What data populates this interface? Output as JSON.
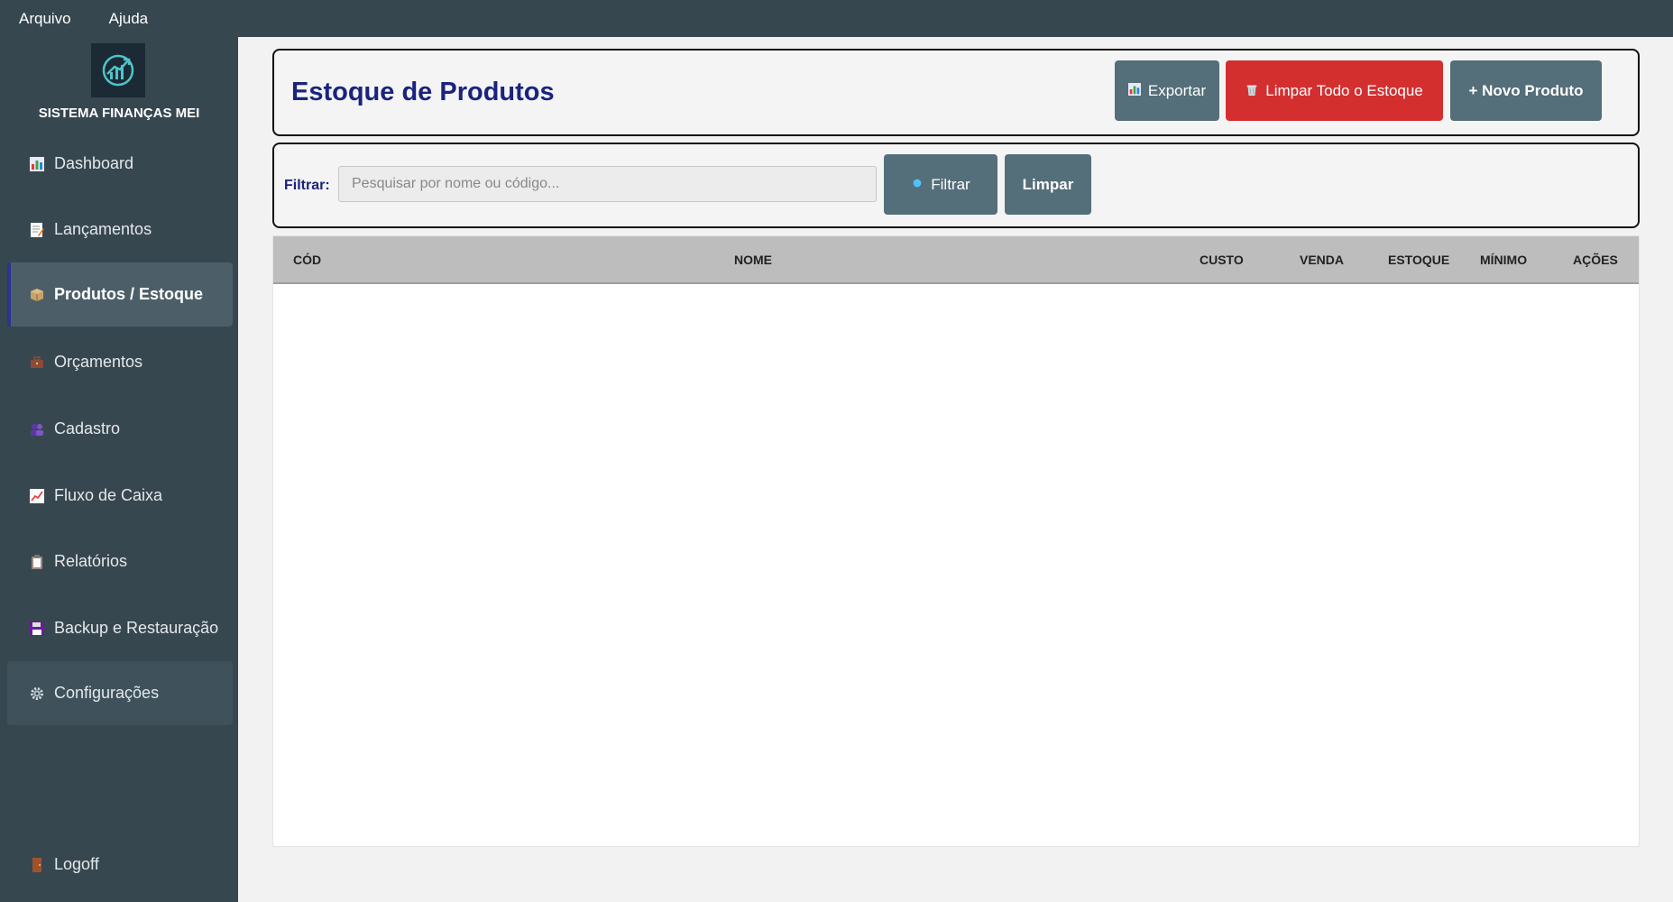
{
  "menubar": {
    "items": [
      "Arquivo",
      "Ajuda"
    ]
  },
  "sidebar": {
    "app_name": "SISTEMA FINANÇAS MEI",
    "logo_icon": "growth-chart-icon",
    "items": [
      {
        "label": "Dashboard",
        "icon": "bar-chart-icon"
      },
      {
        "label": "Lançamentos",
        "icon": "memo-icon"
      },
      {
        "label": "Produtos / Estoque",
        "icon": "package-icon",
        "active": true
      },
      {
        "label": "Orçamentos",
        "icon": "briefcase-icon"
      },
      {
        "label": "Cadastro",
        "icon": "people-icon"
      },
      {
        "label": "Fluxo de Caixa",
        "icon": "line-chart-icon"
      },
      {
        "label": "Relatórios",
        "icon": "clipboard-icon"
      },
      {
        "label": "Backup e Restauração",
        "icon": "floppy-disk-icon"
      },
      {
        "label": "Configurações",
        "icon": "gear-icon"
      }
    ],
    "logoff": {
      "label": "Logoff",
      "icon": "door-icon"
    }
  },
  "header": {
    "title": "Estoque de Produtos",
    "export_label": "Exportar",
    "clear_stock_label": "Limpar Todo o Estoque",
    "new_product_label": "+ Novo Produto"
  },
  "filter": {
    "label": "Filtrar:",
    "placeholder": "Pesquisar por nome ou código...",
    "value": "",
    "filter_button": "Filtrar",
    "clear_button": "Limpar"
  },
  "table": {
    "columns": [
      "CÓD",
      "NOME",
      "CUSTO",
      "VENDA",
      "ESTOQUE",
      "MÍNIMO",
      "AÇÕES"
    ],
    "rows": []
  },
  "colors": {
    "sidebar_bg": "#37474f",
    "active_item_bg": "#4c5f69",
    "title_color": "#1a237e",
    "button_gray": "#546e7a",
    "button_red": "#d32f2f",
    "table_header_bg": "#bdbdbd"
  }
}
